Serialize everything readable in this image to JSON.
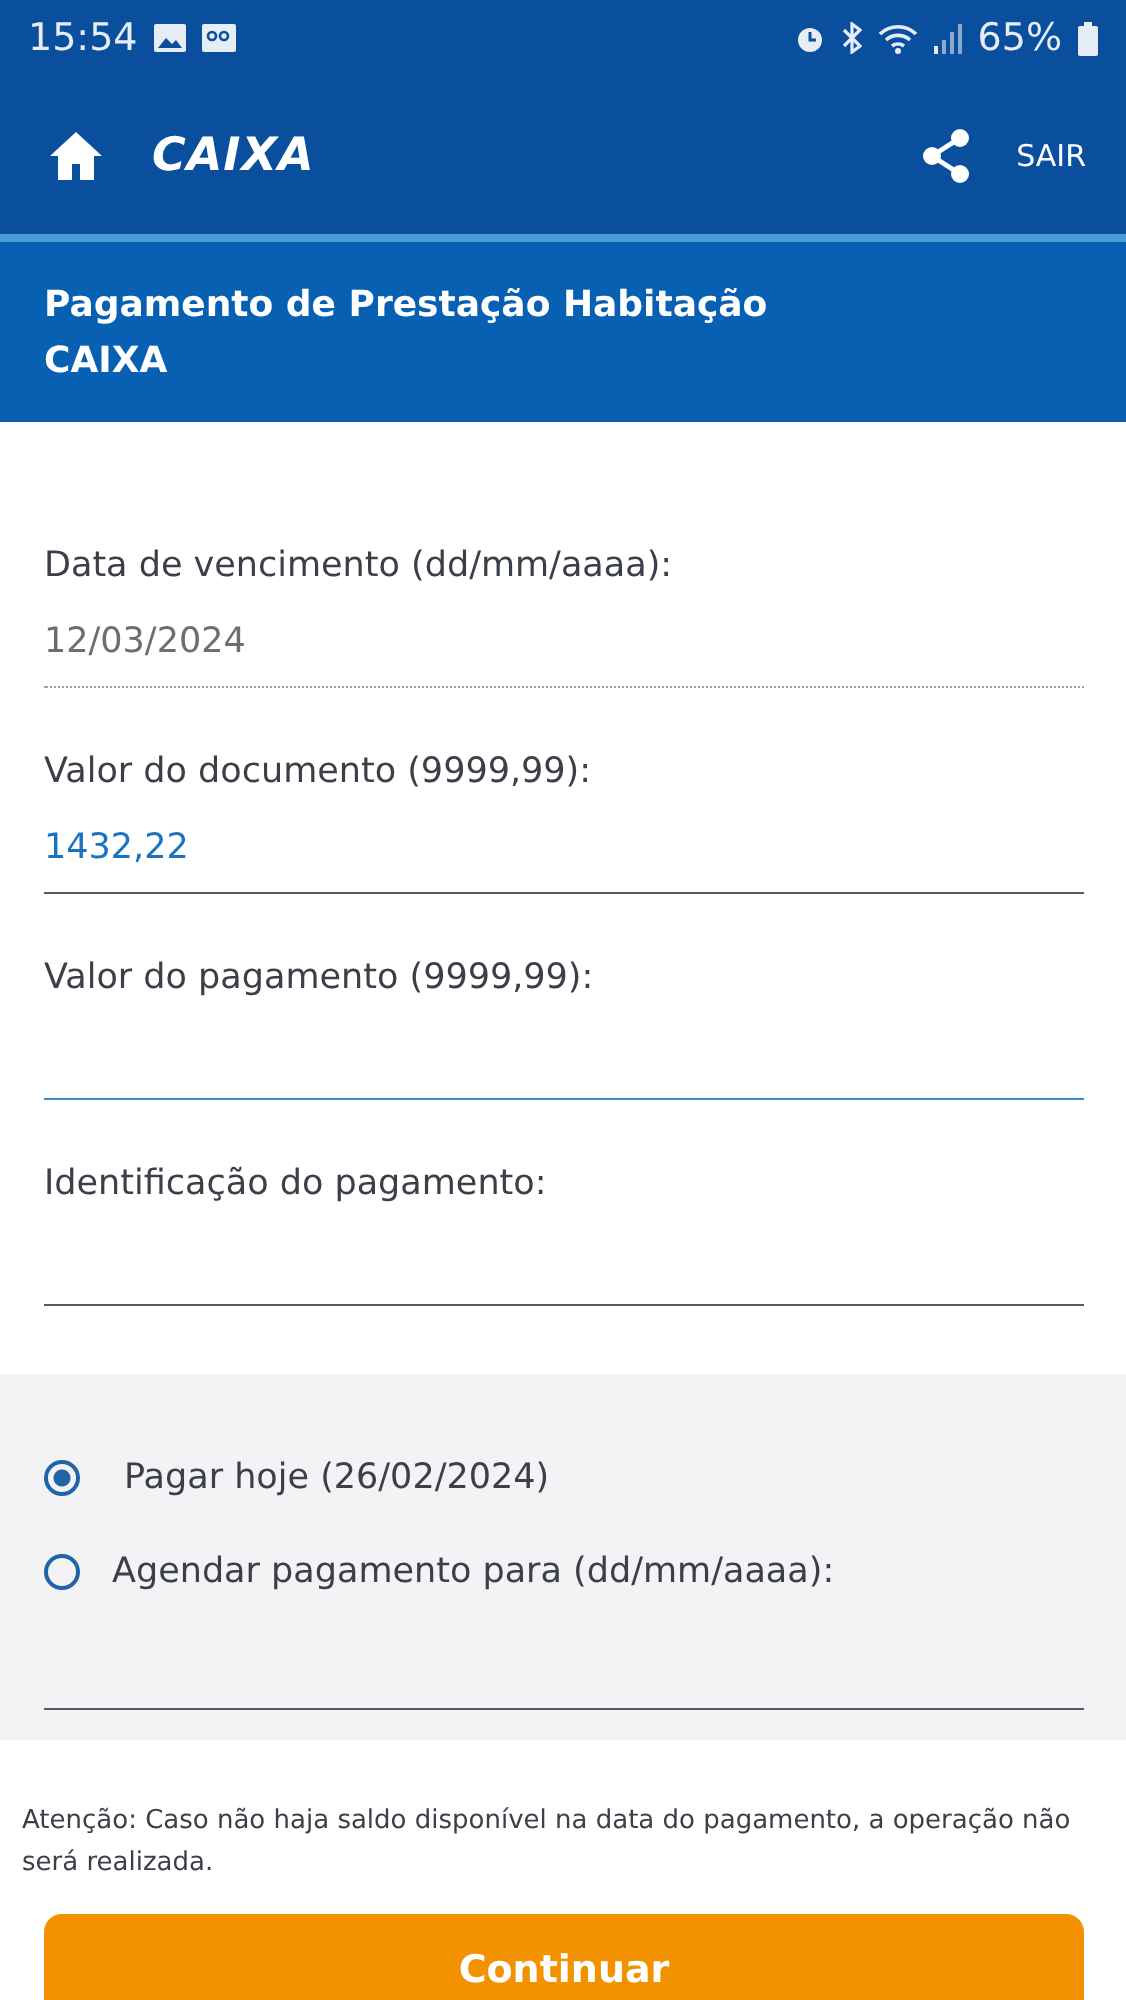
{
  "status_bar": {
    "time": "15:54",
    "battery": "65%"
  },
  "header": {
    "logo": "CAIXA",
    "exit": "SAIR"
  },
  "page_title": "Pagamento de Prestação Habitação CAIXA",
  "fields": [
    {
      "label": "Data de vencimento (dd/mm/aaaa):",
      "value": "12/03/2024",
      "disabled": true,
      "focused": false
    },
    {
      "label": "Valor do documento (9999,99):",
      "value": "1432,22",
      "disabled": false,
      "focused": false
    },
    {
      "label": "Valor do pagamento (9999,99):",
      "disabled": false,
      "focused": true
    },
    {
      "label": "Identificação do pagamento:",
      "disabled": false,
      "focused": false
    }
  ],
  "payment_options": [
    {
      "label": "Pagar hoje (26/02/2024)",
      "selected": true
    },
    {
      "label": "Agendar pagamento para (dd/mm/aaaa):",
      "selected": false
    }
  ],
  "notice": "Atenção: Caso não haja saldo disponível na data do pagamento, a operação não será realizada.",
  "button": "Continuar"
}
